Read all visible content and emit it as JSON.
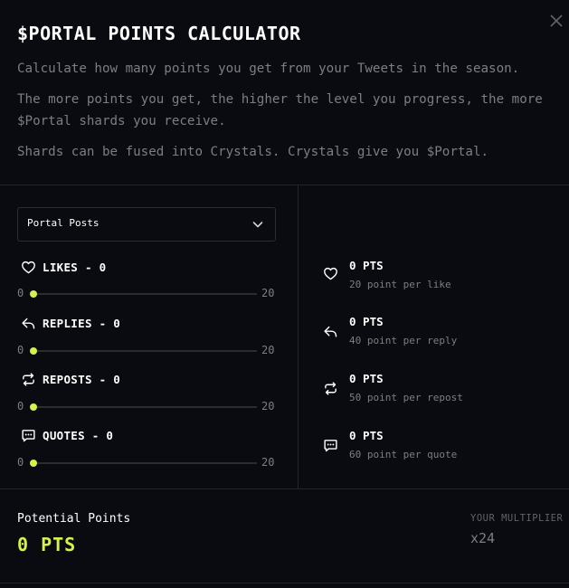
{
  "title": "$PORTAL POINTS CALCULATOR",
  "description": [
    "Calculate how many points you get from your Tweets in the season.",
    "The more points you get, the higher the level you progress, the more $Portal shards you receive.",
    "Shards can be fused into Crystals. Crystals give you $Portal."
  ],
  "select": {
    "value": "Portal Posts"
  },
  "metrics": [
    {
      "label": "LIKES - 0",
      "icon": "heart-icon",
      "min": "0",
      "max": "20",
      "fraction": 0,
      "pts": "0 PTS",
      "rate": "20 point per like"
    },
    {
      "label": "REPLIES - 0",
      "icon": "reply-icon",
      "min": "0",
      "max": "20",
      "fraction": 0,
      "pts": "0 PTS",
      "rate": "40 point per reply"
    },
    {
      "label": "REPOSTS - 0",
      "icon": "repost-icon",
      "min": "0",
      "max": "20",
      "fraction": 0,
      "pts": "0 PTS",
      "rate": "50 point per repost"
    },
    {
      "label": "QUOTES - 0",
      "icon": "quote-icon",
      "min": "0",
      "max": "20",
      "fraction": 0,
      "pts": "0 PTS",
      "rate": "60 point per quote"
    }
  ],
  "footer": {
    "label": "Potential Points",
    "total": "0 PTS",
    "multiplier_label": "YOUR MULTIPLIER",
    "multiplier_value": "x24"
  },
  "colors": {
    "background": "#0a0b10",
    "accent": "#d4f24a",
    "muted": "#7a7e86",
    "divider": "#23252c"
  }
}
